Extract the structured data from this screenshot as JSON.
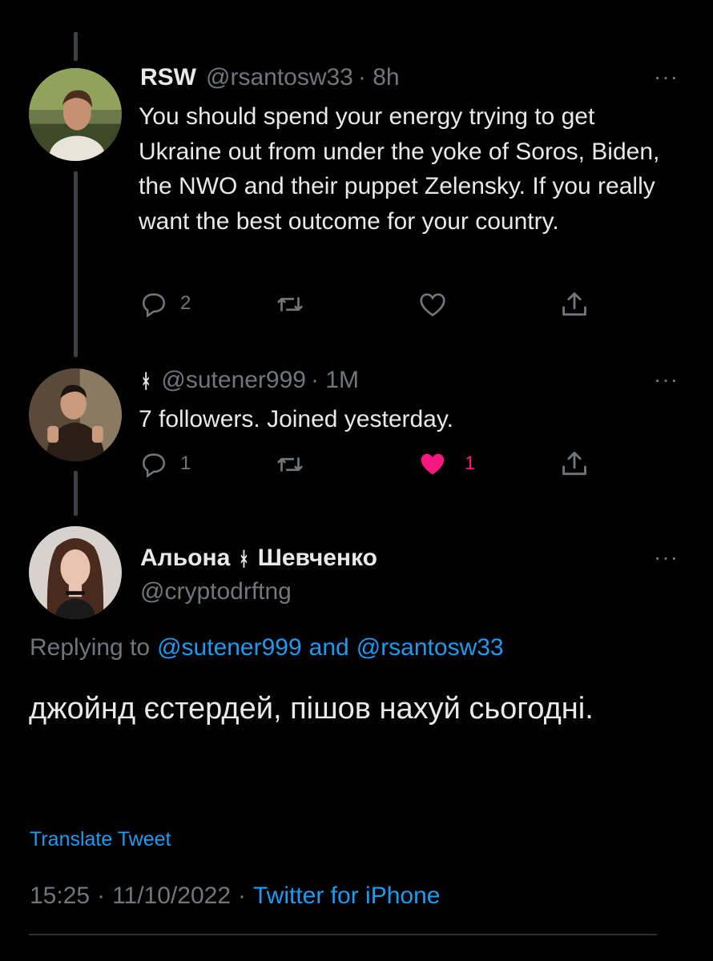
{
  "tweet1": {
    "display_name": "RSW",
    "handle": "@rsantosw33",
    "time": "· 8h",
    "text": "You should spend your energy trying to get Ukraine out from under the yoke of Soros, Biden, the NWO and their puppet Zelensky. If you really want the best outcome for your country.",
    "reply_count": "2",
    "retweet_count": "",
    "like_count": ""
  },
  "tweet2": {
    "display_name": "ᚼ",
    "handle": "@sutener999",
    "time": "· 1M",
    "text": "7 followers. Joined yesterday.",
    "reply_count": "1",
    "like_count": "1",
    "liked": true
  },
  "main_tweet": {
    "display_name_part1": "Альона",
    "rune": "ᚼ",
    "display_name_part2": "Шевченко",
    "handle": "@cryptodrftng",
    "replying_prefix": "Replying to",
    "reply_to_1": "@sutener999",
    "reply_and": "and",
    "reply_to_2": "@rsantosw33",
    "text": "джойнд єстердей, пішов нахуй сьогодні.",
    "translate_label": "Translate Tweet",
    "time": "15:25",
    "date": "11/10/2022",
    "source": "Twitter for iPhone"
  },
  "more_label": "···",
  "colors": {
    "background": "#000000",
    "text": "#e7e9ea",
    "muted": "#71767b",
    "link": "#1d9bf0",
    "like_active": "#f91880",
    "thread_line": "#3e4144"
  }
}
